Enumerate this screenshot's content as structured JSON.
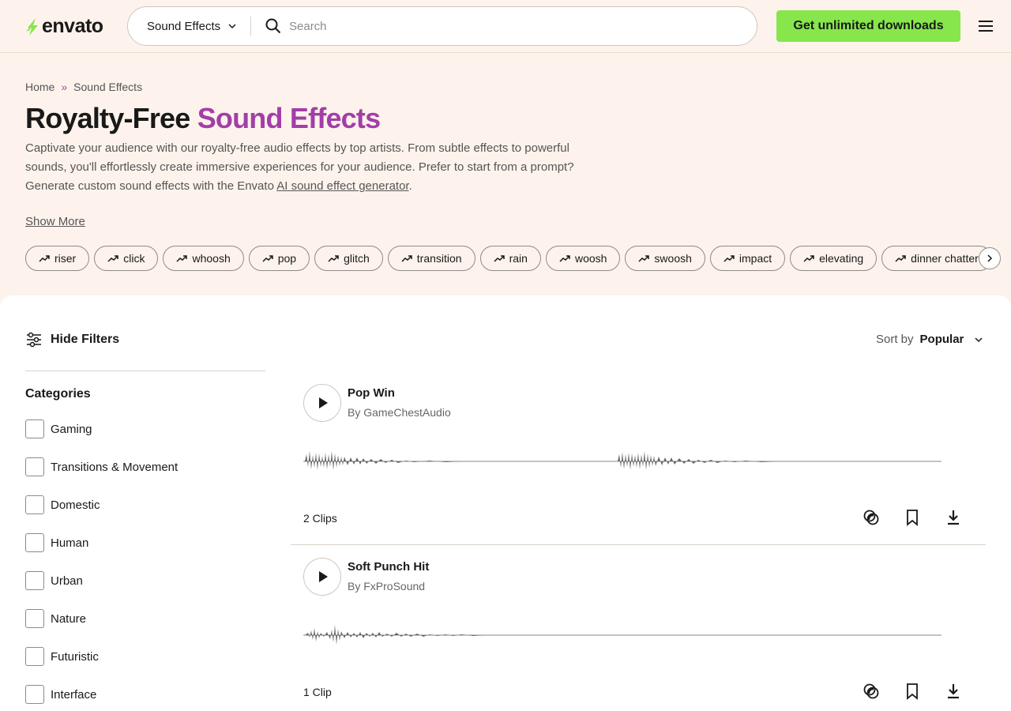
{
  "header": {
    "logo": "envato",
    "search_category": "Sound Effects",
    "search_placeholder": "Search",
    "cta": "Get unlimited downloads"
  },
  "breadcrumb": [
    "Home",
    "»",
    "Sound Effects"
  ],
  "hero": {
    "title_plain": "Royalty-Free ",
    "title_accent": "Sound Effects",
    "desc_part1": "Captivate your audience with our royalty-free audio effects by top artists. From subtle effects to powerful sounds, you'll effortlessly create immersive experiences for your audience. Prefer to start from a prompt? Generate custom sound effects with the Envato ",
    "desc_link": "AI sound effect generator",
    "desc_end": ".",
    "show_more": "Show More"
  },
  "tags": [
    "riser",
    "click",
    "whoosh",
    "pop",
    "glitch",
    "transition",
    "rain",
    "woosh",
    "swoosh",
    "impact",
    "elevating",
    "dinner chatter"
  ],
  "filters": {
    "toggle": "Hide Filters",
    "categories_title": "Categories",
    "categories": [
      "Gaming",
      "Transitions & Movement",
      "Domestic",
      "Human",
      "Urban",
      "Nature",
      "Futuristic",
      "Interface"
    ]
  },
  "sort": {
    "label": "Sort by",
    "value": "Popular"
  },
  "tracks": [
    {
      "title": "Pop Win",
      "author": "By GameChestAudio",
      "clips": "2 Clips"
    },
    {
      "title": "Soft Punch Hit",
      "author": "By FxProSound",
      "clips": "1 Clip"
    }
  ],
  "colors": {
    "accent_purple": "#a23ea8",
    "cta_green": "#87e64b",
    "hero_bg": "#fdf3ec"
  }
}
